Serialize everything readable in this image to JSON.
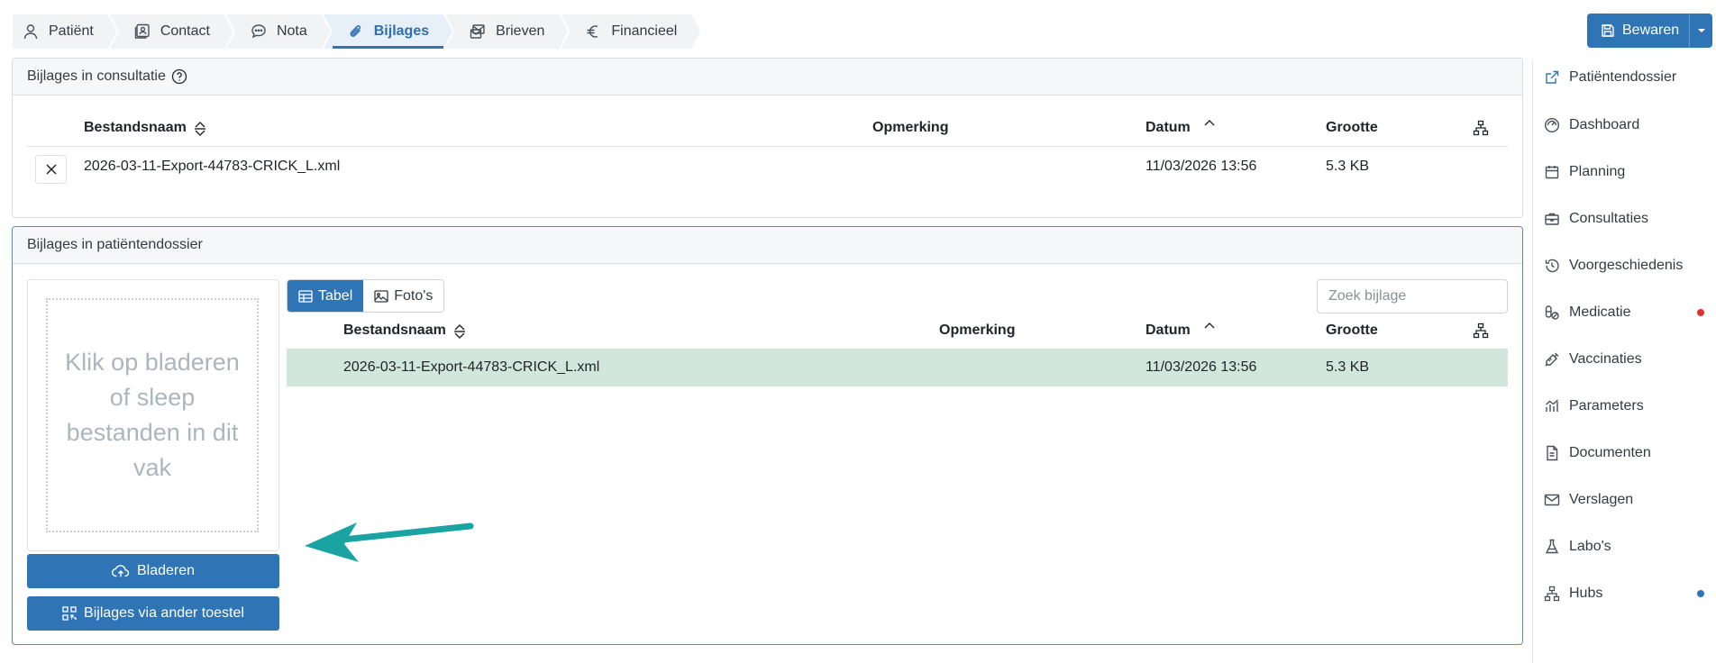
{
  "tabs": [
    {
      "label": "Patiënt",
      "icon": "user-icon"
    },
    {
      "label": "Contact",
      "icon": "contact-card-icon"
    },
    {
      "label": "Nota",
      "icon": "chat-icon"
    },
    {
      "label": "Bijlages",
      "icon": "paperclip-icon",
      "active": true
    },
    {
      "label": "Brieven",
      "icon": "letters-icon"
    },
    {
      "label": "Financieel",
      "icon": "euro-icon"
    }
  ],
  "save": {
    "label": "Bewaren"
  },
  "consult_panel": {
    "title": "Bijlages in consultatie",
    "columns": {
      "filename": "Bestandsnaam",
      "remark": "Opmerking",
      "date": "Datum",
      "size": "Grootte"
    },
    "rows": [
      {
        "filename": "2026-03-11-Export-44783-CRICK_L.xml",
        "remark": "",
        "date": "11/03/2026 13:56",
        "size": "5.3 KB"
      }
    ]
  },
  "dossier_panel": {
    "title": "Bijlages in patiëntendossier",
    "dropzone_text": "Klik op bladeren of sleep bestanden in dit vak",
    "browse_label": "Bladeren",
    "other_device_label": "Bijlages via ander toestel",
    "view_toggle": {
      "table": "Tabel",
      "photos": "Foto's"
    },
    "search_placeholder": "Zoek bijlage",
    "columns": {
      "filename": "Bestandsnaam",
      "remark": "Opmerking",
      "date": "Datum",
      "size": "Grootte"
    },
    "rows": [
      {
        "filename": "2026-03-11-Export-44783-CRICK_L.xml",
        "remark": "",
        "date": "11/03/2026 13:56",
        "size": "5.3 KB"
      }
    ]
  },
  "sidebar": {
    "items": [
      {
        "label": "Patiëntendossier",
        "icon": "external-link-icon"
      },
      {
        "label": "Dashboard",
        "icon": "dashboard-icon"
      },
      {
        "label": "Planning",
        "icon": "calendar-icon"
      },
      {
        "label": "Consultaties",
        "icon": "briefcase-icon"
      },
      {
        "label": "Voorgeschiedenis",
        "icon": "history-icon"
      },
      {
        "label": "Medicatie",
        "icon": "pills-icon",
        "badge_color": "#e03131"
      },
      {
        "label": "Vaccinaties",
        "icon": "syringe-icon"
      },
      {
        "label": "Parameters",
        "icon": "chart-icon"
      },
      {
        "label": "Documenten",
        "icon": "document-icon"
      },
      {
        "label": "Verslagen",
        "icon": "envelope-icon"
      },
      {
        "label": "Labo's",
        "icon": "flask-icon"
      },
      {
        "label": "Hubs",
        "icon": "hubs-icon",
        "badge_color": "#2f75b6"
      }
    ]
  },
  "colors": {
    "accent": "#2f75b6",
    "selected_row": "#d1e7dd",
    "arrow": "#1aa3a3"
  }
}
